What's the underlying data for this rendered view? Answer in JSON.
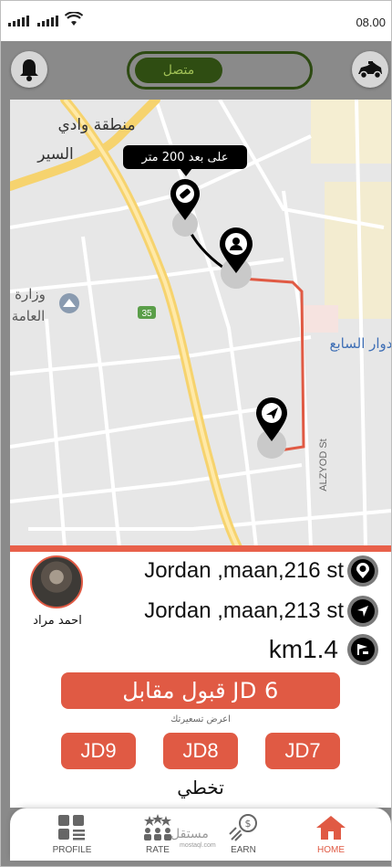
{
  "status_bar": {
    "time": "08.00"
  },
  "header": {
    "status_toggle_label": "متصل"
  },
  "map": {
    "distance_label": "على بعد 200 متر",
    "labels": {
      "district": "منطقة وادي",
      "district_2": "السير",
      "ministry": "وزارة",
      "ministry_2": "العامة",
      "road_number": "35",
      "seventh_circle": "دوار السابع",
      "street": "ALZYOD St"
    },
    "route_color": "#e05a44"
  },
  "rider": {
    "name": "احمد مراد"
  },
  "trip": {
    "pickup": "Jordan ,maan,216 st",
    "dropoff": "Jordan ,maan,213 st",
    "distance": "km1.4"
  },
  "actions": {
    "accept": "قبول مقابل  JD 6",
    "offer_label": "اعرض تسعيرتك",
    "prices": [
      "JD9",
      "JD8",
      "JD7"
    ],
    "skip": "تخطي"
  },
  "nav": {
    "items": [
      {
        "label": "PROFILE",
        "icon": "profile-grid-icon"
      },
      {
        "label": "RATE",
        "icon": "rate-stars-icon"
      },
      {
        "label": "EARN",
        "icon": "earn-coin-icon"
      },
      {
        "label": "HOME",
        "icon": "home-icon",
        "active": true
      }
    ],
    "watermark": "مستقل",
    "watermark_sub": "mostaql.com"
  },
  "colors": {
    "accent": "#e05a44",
    "toggle": "#2f4d12",
    "header": "#8a8a8a"
  }
}
